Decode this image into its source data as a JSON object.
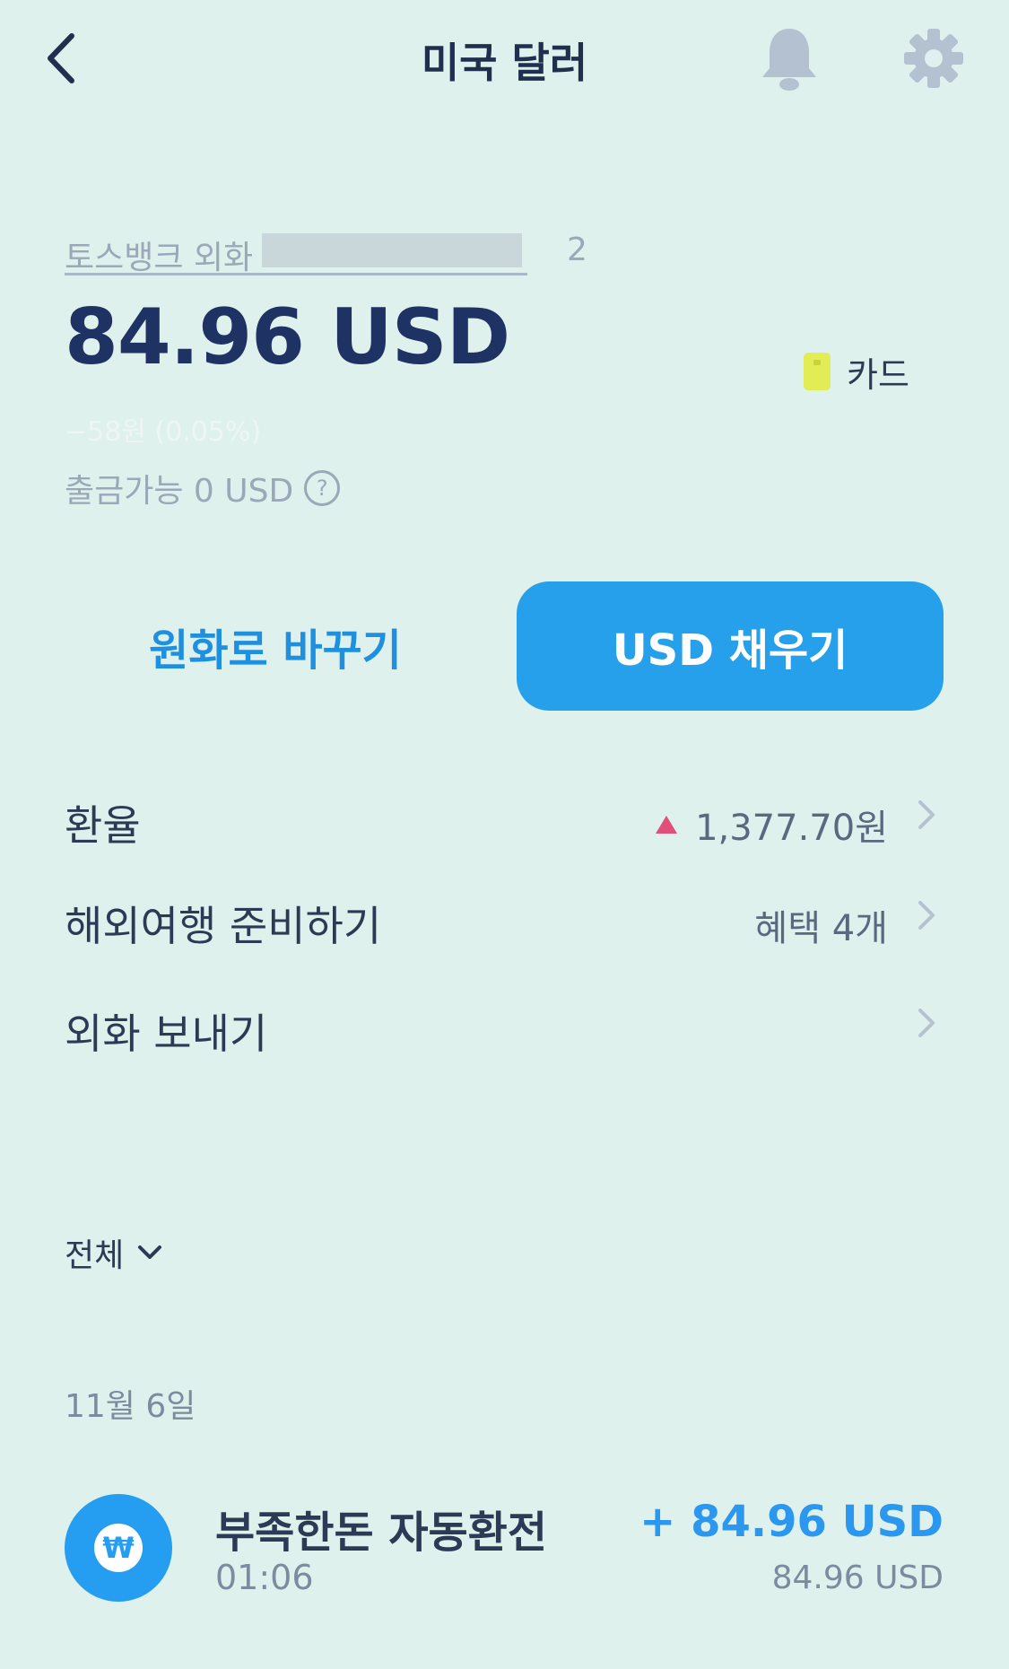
{
  "header": {
    "title": "미국 달러",
    "back_icon": "chevron-left-icon",
    "bell_icon": "bell-icon",
    "settings_icon": "gear-icon"
  },
  "account": {
    "name": "토스뱅크 외화",
    "number_tail": "2",
    "balance": "84.96 USD",
    "change": "−58원 (0.05%)",
    "withdrawable": "출금가능 0 USD",
    "help_symbol": "?",
    "card_label": "카드",
    "card_color": "#e2ec55"
  },
  "actions": {
    "exchange_label": "원화로 바꾸기",
    "fill_label": "USD 채우기",
    "fill_color": "#26a0ea"
  },
  "menu": [
    {
      "label": "환율",
      "value": "1,377.70원",
      "trend": "up",
      "trend_color": "#e0507a"
    },
    {
      "label": "해외여행 준비하기",
      "value": "혜택 4개"
    },
    {
      "label": "외화 보내기",
      "value": ""
    }
  ],
  "filter": {
    "label": "전체"
  },
  "transactions": {
    "date": "11월 6일",
    "items": [
      {
        "title": "부족한돈 자동환전",
        "time": "01:06",
        "amount": "+ 84.96 USD",
        "balance_after": "84.96 USD",
        "icon_symbol": "₩",
        "icon_color": "#259df0"
      }
    ]
  }
}
